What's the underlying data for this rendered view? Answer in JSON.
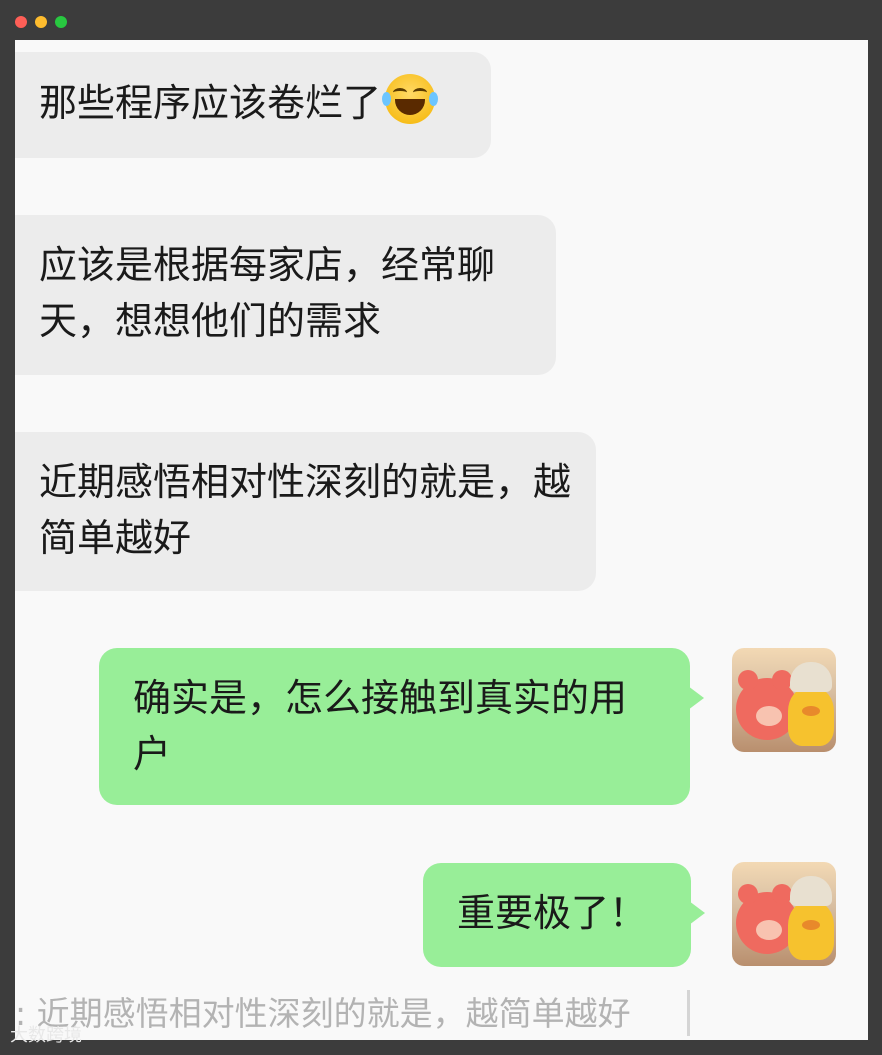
{
  "window": {
    "controls": [
      "close",
      "minimize",
      "maximize"
    ]
  },
  "messages": [
    {
      "side": "in",
      "text": "那些程序应该卷烂了",
      "emoji": "face-with-tears-of-joy-icon"
    },
    {
      "side": "in",
      "text": "应该是根据每家店，经常聊天，想想他们的需求"
    },
    {
      "side": "in",
      "text": "近期感悟相对性深刻的就是，越简单越好"
    },
    {
      "side": "out",
      "text": "确实是，怎么接触到真实的用户",
      "avatar": "user-avatar"
    },
    {
      "side": "out",
      "text": "重要极了！",
      "avatar": "user-avatar"
    }
  ],
  "quote_preview": ": 近期感悟相对性深刻的就是，越简单越好",
  "watermark": "大数跨境",
  "colors": {
    "incoming_bubble": "#ececec",
    "outgoing_bubble": "#98ee98",
    "background": "#f9f9f9",
    "frame": "#3c3c3c"
  }
}
